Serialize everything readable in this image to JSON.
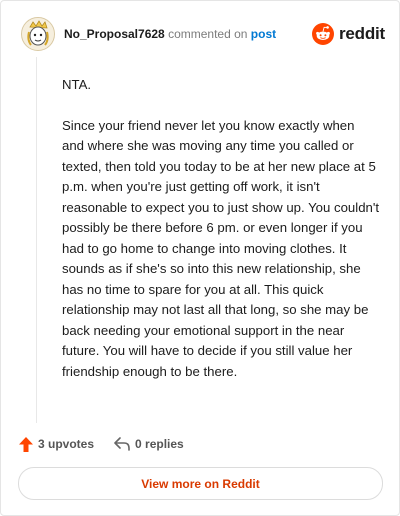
{
  "header": {
    "username": "No_Proposal7628",
    "action_text": "commented on",
    "post_link": "post",
    "brand": "reddit"
  },
  "comment": {
    "paragraphs": [
      "NTA.",
      "Since your friend never let you know exactly when and where she was moving any time you called or texted, then told you today to be at her new place at 5 p.m. when you're just getting off work, it isn't reasonable to expect you to just show up. You couldn't possibly be there before 6 pm. or even longer if you had to go home to change into moving clothes. It sounds as if she's so into this new relationship, she has no time to spare for you at all. This quick relationship may not last all that long, so she may be back needing your emotional support in the near future. You will have to decide if you still value her friendship enough to be there."
    ]
  },
  "footer": {
    "upvotes_label": "3 upvotes",
    "replies_label": "0 replies"
  },
  "cta": {
    "label": "View more on Reddit"
  },
  "colors": {
    "brand": "#ff4500",
    "upvote": "#ff4500",
    "link": "#0079d3",
    "cta_text": "#d93a00"
  }
}
